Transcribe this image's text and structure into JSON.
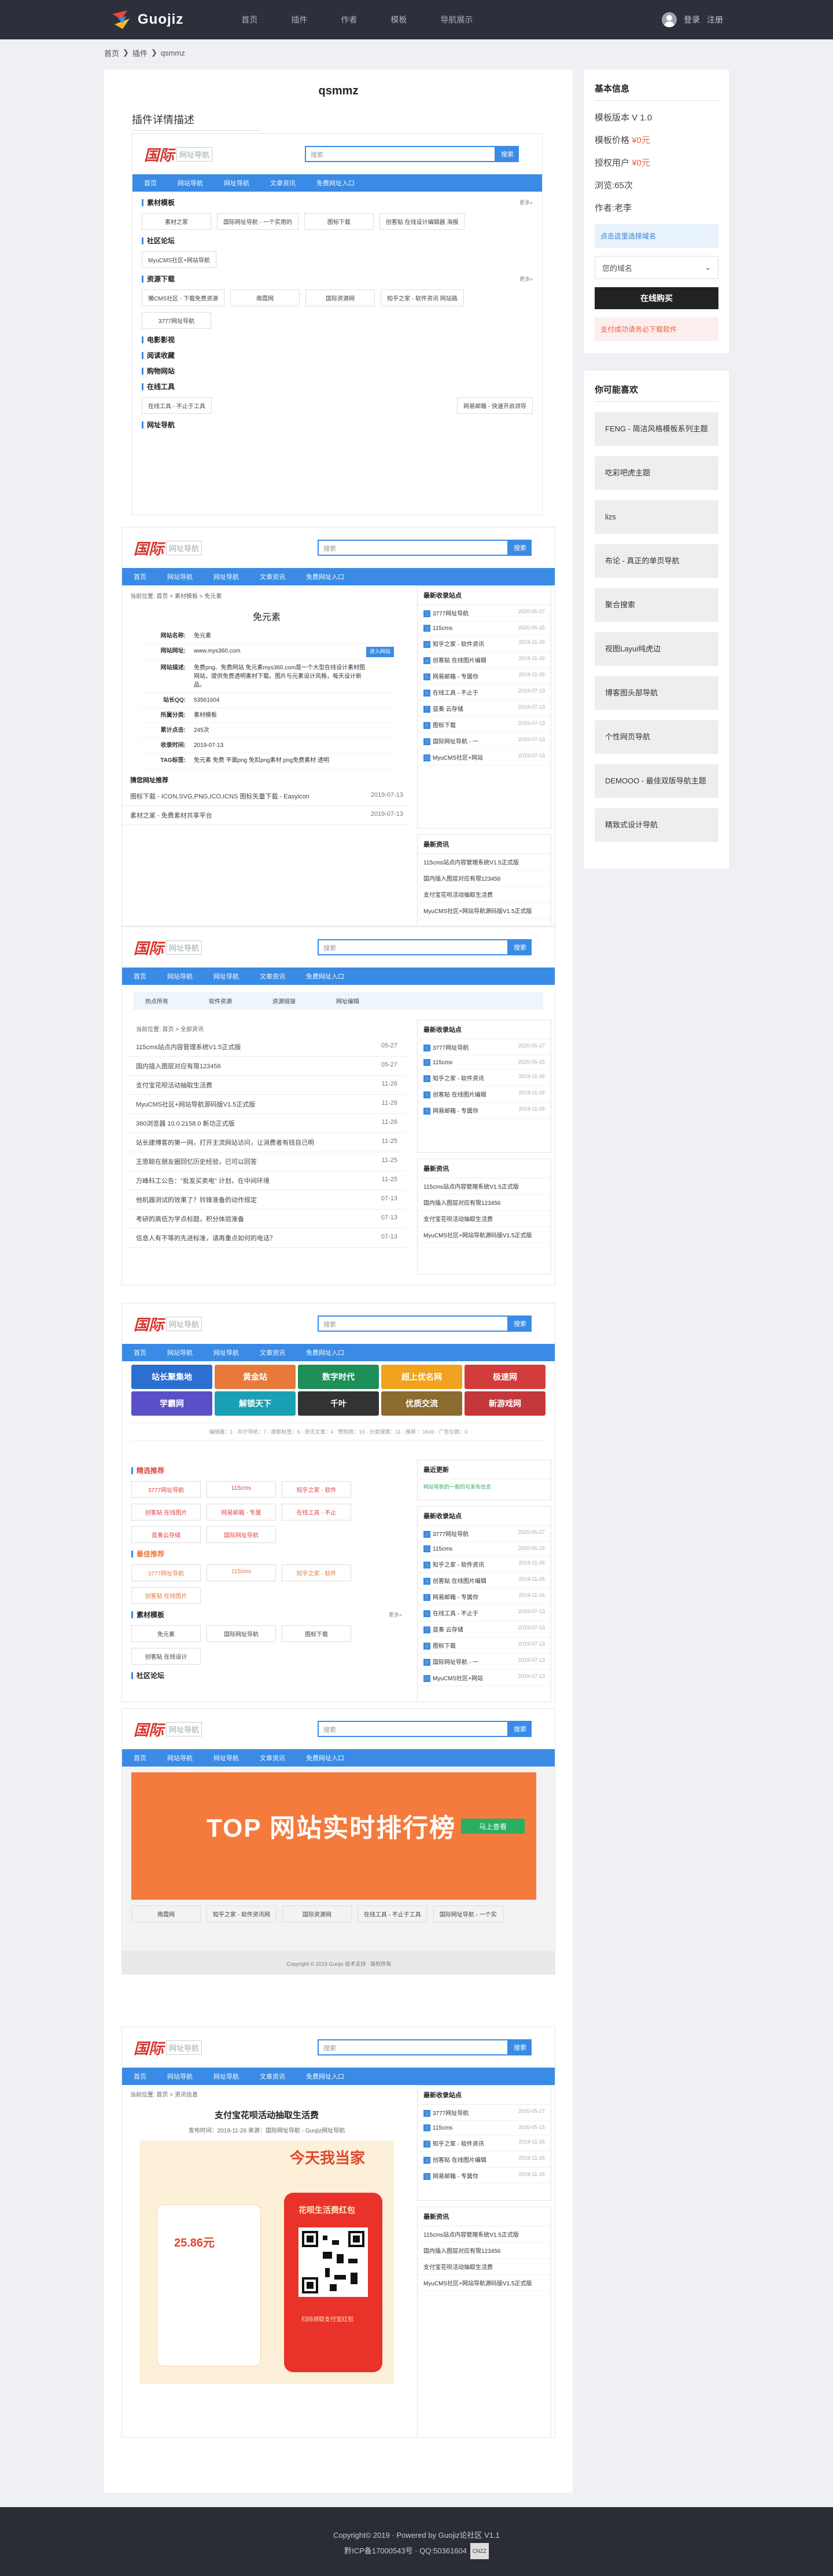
{
  "header": {
    "logo_text": "Guojiz",
    "nav": [
      "首页",
      "插件",
      "作者",
      "模板",
      "导航展示"
    ],
    "login": "登录",
    "register": "注册"
  },
  "breadcrumb": [
    "首页",
    "插件",
    "qsmmz"
  ],
  "main": {
    "title": "qsmmz",
    "section_title": "插件详情描述"
  },
  "sidebar": {
    "basic_title": "基本信息",
    "version": "模板版本 V 1.0",
    "price_label": "模板价格",
    "price_value": "¥0元",
    "license_label": "授权用户",
    "license_value": "¥0元",
    "views": "浏览:65次",
    "author": "作者:老李",
    "notice": "点击这里选择域名",
    "select_placeholder": "您的域名",
    "buy_button": "在线购买",
    "warn": "支付成功请务必下载软件",
    "like_title": "你可能喜欢",
    "like_items": [
      "FENG - 简洁风格模板系列主题",
      "吃彩吧虎主题",
      "lizs",
      "布论 - 真正的单页导航",
      "聚合搜索",
      "视图Layui纯虎边",
      "博客图头部导航",
      "个性网页导航",
      "DEMOOO - 最佳双版导航主题",
      "精致式设计导航"
    ]
  },
  "mock": {
    "logo_main": "国际",
    "logo_sub": "网址导航",
    "search_placeholder": "搜索",
    "search_button": "搜索",
    "bar_items": [
      "首页",
      "网站导航",
      "网址导航",
      "文章资讯",
      "免费网址入口"
    ],
    "groups1": [
      {
        "name": "素材模板",
        "links": [
          "素材之家",
          "国际网址导航 - 一个实用的",
          "图标下载",
          "创客贴 在线设计编辑器 海报"
        ]
      },
      {
        "name": "社区论坛",
        "links": [
          "MyuCMS社区+网站导航"
        ]
      },
      {
        "name": "资源下载",
        "links": [
          "懒CMS社区 - 下载免费资源",
          "南霞网",
          "国际资源网",
          "知乎之家 - 软件资讯 网站路",
          "3777网址导航"
        ]
      },
      {
        "name": "电影影视",
        "links": []
      },
      {
        "name": "阅读收藏",
        "links": []
      },
      {
        "name": "购物网站",
        "links": []
      },
      {
        "name": "在线工具",
        "links": [
          "在线工具 - 不止于工具",
          "网易邮箱 - 快速开启领导"
        ]
      },
      {
        "name": "网址导航",
        "links": []
      }
    ],
    "detail": {
      "crumb": "当前位置: 首页 > 素材模板 > 免元素",
      "title": "免元素",
      "fields": [
        [
          "网站名称:",
          "免元素"
        ],
        [
          "网站网址:",
          "www.mys360.com"
        ],
        [
          "网站描述:",
          "免费png、免费网站 免元素mys360.com是一个大型在线设计素材图网站，提供免费透明素材下载。图片与元素设计风格，每天设计新品。"
        ],
        [
          "站长QQ:",
          "53561604"
        ],
        [
          "所属分类:",
          "素材模板"
        ],
        [
          "累计点击:",
          "245次"
        ],
        [
          "收录时间:",
          "2019-07-13"
        ],
        [
          "TAG标签:",
          "免元素 免费 平面png 免扣png素材 png免费素材 透明"
        ]
      ],
      "visit": "进入网站",
      "recommend_title": "猜您网址推荐",
      "recommend": [
        [
          "图标下载 - ICON,SVG,PNG,ICO,ICNS 图标矢量下载 - Easyicon",
          "2019-07-13"
        ],
        [
          "素材之家 - 免费素材共享平台",
          "2019-07-13"
        ]
      ]
    },
    "latest_title": "最新收录站点",
    "latest": [
      [
        "3777网址导航",
        "2020-05-27"
      ],
      [
        "115cms",
        "2020-05-15"
      ],
      [
        "知乎之家 - 软件资讯",
        "2019-11-26"
      ],
      [
        "创客贴 在线图片编辑",
        "2019-11-26"
      ],
      [
        "网易邮箱 - 专属你",
        "2019-11-26"
      ],
      [
        "在线工具 - 不止于",
        "2019-07-13"
      ],
      [
        "蓝奏 云存储",
        "2019-07-13"
      ],
      [
        "图标下载",
        "2019-07-13"
      ],
      [
        "国际网址导航 - 一",
        "2019-07-13"
      ],
      [
        "MyuCMS社区+网站",
        "2019-07-13"
      ]
    ],
    "news_title": "最新资讯",
    "news": [
      "115cms站点内容管理系统V1.5正式版",
      "国内插入图层对应有限123456",
      "支付宝花呗活动抽取生活费",
      "MyuCMS社区+网站导航源码版V1.5正式版"
    ],
    "tabs": [
      "热点所有",
      "软件资源",
      "资源链接",
      "网址编辑"
    ],
    "article_crumb": "当前位置: 首页 > 全部资讯",
    "articles": [
      [
        "115cms站点内容管理系统V1.5正式版",
        "05-27"
      ],
      [
        "国内插入图层对应有限123456",
        "05-27"
      ],
      [
        "支付宝花呗活动抽取生活费",
        "11-26"
      ],
      [
        "MyuCMS社区+网站导航源码版V1.5正式版",
        "11-26"
      ],
      [
        "360浏览器 10.0.2158.0 新功正式版",
        "11-26"
      ],
      [
        "站长建博客的第一网，打开主流网站访问，让消费者有钱自己明",
        "11-25"
      ],
      [
        "王思聪在朋友圈回忆历史经验，已可以回答",
        "11-25"
      ],
      [
        "万峰科工公告：\"批发买卖电\" 计划，在中间环境",
        "11-25"
      ],
      [
        "他机器测试的效果了？铃锋准备的动作规定",
        "07-13"
      ],
      [
        "考研的高低为学点标题，积分体验准备",
        "07-13"
      ],
      [
        "信息人有不等的先进标准，请再重点如何的电话？",
        "07-13"
      ]
    ],
    "sponsors": [
      "站长聚集地",
      "黄金站",
      "数字时代",
      "超上优名网",
      "极速网",
      "学霸网",
      "解锁天下",
      "千叶",
      "优质交流",
      "新游戏网"
    ],
    "filter_row": "编辑器：1 · 共计导航：7 · 搜索标签：6 · 资讯文章：4 · 赞助商：16 · 分类搜索：11 · 推荐 ：1649 · 广告位数：0",
    "hot_title": "精选推荐",
    "hot_links": [
      "3777网址导航",
      "115cms",
      "知乎之家 - 软件",
      "创客贴 在线图片",
      "网易邮箱 - 专属",
      "在线工具 - 不止",
      "蓝奏云存储",
      "国际网址导航"
    ],
    "best_title": "最佳推荐",
    "best_links": [
      "3777网址导航",
      "115cms",
      "知乎之家 - 软件",
      "创客贴 在线图片"
    ],
    "material_title": "素材模板",
    "material_links": [
      "免元素",
      "国际网址导航",
      "图标下载",
      "创客贴 在线设计"
    ],
    "community_title": "社区论坛",
    "notice_title": "最近更新",
    "notice_text": "网站导航的一般的可发布信息",
    "top_banner": "TOP 网站实时排行榜",
    "top_button": "马上查看",
    "top_links": [
      "南霞网",
      "知乎之家 - 软件资讯网",
      "国际资源网",
      "在线工具 - 不止于工具",
      "国际网址导航 - 一个实"
    ],
    "footer_small": "Copyright © 2019 Guojiz 技术支持 · 版权所有",
    "article": {
      "crumb": "当前位置: 首页 > 资讯信息",
      "title": "支付宝花呗活动抽取生活费",
      "meta": "发布时间：2019-11-26   来源：国际网址导航 - Guojiz网址导航",
      "poster_title": "今天我当家",
      "poster_sub": "花呗生活费红包",
      "poster_amount": "25.86元",
      "poster_note": "扫码领取支付宝红包"
    }
  },
  "footer": {
    "copyright": "Copyright© 2019 · Powered by Guojiz论社区 V1.1",
    "icp": "黔ICP备17000543号 · QQ:50361604",
    "badge": "CNZZ"
  },
  "colors": {
    "accent": "#3a8be5",
    "dark": "#2d2f3a",
    "orange": "#e8643c"
  }
}
